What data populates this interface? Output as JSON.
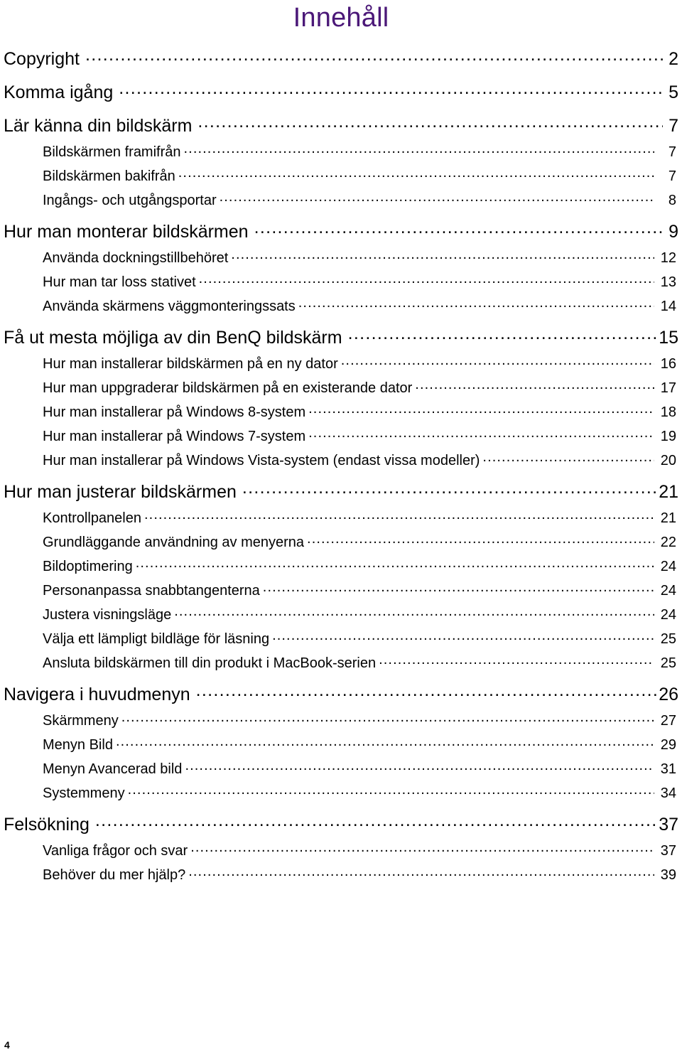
{
  "document": {
    "title": "Innehåll",
    "title_color": "#4B1878",
    "footer_page_number": "4"
  },
  "toc": {
    "entries": [
      {
        "level": 1,
        "label": "Copyright",
        "page": "2"
      },
      {
        "level": 1,
        "label": "Komma igång",
        "page": "5"
      },
      {
        "level": 1,
        "label": "Lär känna din bildskärm",
        "page": "7"
      },
      {
        "level": 2,
        "label": "Bildskärmen framifrån",
        "page": "7"
      },
      {
        "level": 2,
        "label": "Bildskärmen bakifrån",
        "page": "7"
      },
      {
        "level": 2,
        "label": "Ingångs- och utgångsportar",
        "page": "8"
      },
      {
        "level": 1,
        "label": "Hur man monterar bildskärmen",
        "page": "9"
      },
      {
        "level": 2,
        "label": "Använda dockningstillbehöret",
        "page": "12"
      },
      {
        "level": 2,
        "label": "Hur man tar loss stativet",
        "page": "13"
      },
      {
        "level": 2,
        "label": "Använda skärmens väggmonteringssats",
        "page": "14"
      },
      {
        "level": 1,
        "label": "Få ut mesta möjliga av din BenQ bildskärm",
        "page": "15"
      },
      {
        "level": 2,
        "label": "Hur man installerar bildskärmen på en ny dator",
        "page": "16"
      },
      {
        "level": 2,
        "label": "Hur man uppgraderar bildskärmen på en existerande dator",
        "page": "17"
      },
      {
        "level": 2,
        "label": "Hur man installerar på Windows 8-system",
        "page": "18"
      },
      {
        "level": 2,
        "label": "Hur man installerar på Windows 7-system",
        "page": "19"
      },
      {
        "level": 2,
        "label": "Hur man installerar på Windows Vista-system (endast vissa modeller)",
        "page": "20"
      },
      {
        "level": 1,
        "label": "Hur man justerar bildskärmen",
        "page": "21"
      },
      {
        "level": 2,
        "label": "Kontrollpanelen",
        "page": "21"
      },
      {
        "level": 2,
        "label": "Grundläggande användning av menyerna",
        "page": "22"
      },
      {
        "level": 2,
        "label": "Bildoptimering",
        "page": "24"
      },
      {
        "level": 2,
        "label": "Personanpassa snabbtangenterna",
        "page": "24"
      },
      {
        "level": 2,
        "label": "Justera visningsläge",
        "page": "24"
      },
      {
        "level": 2,
        "label": "Välja ett lämpligt bildläge för läsning",
        "page": "25"
      },
      {
        "level": 2,
        "label": "Ansluta bildskärmen till din produkt i MacBook-serien",
        "page": "25"
      },
      {
        "level": 1,
        "label": "Navigera i huvudmenyn",
        "page": "26"
      },
      {
        "level": 2,
        "label": "Skärmmeny",
        "page": "27"
      },
      {
        "level": 2,
        "label": "Menyn Bild",
        "page": "29"
      },
      {
        "level": 2,
        "label": "Menyn Avancerad bild",
        "page": "31"
      },
      {
        "level": 2,
        "label": "Systemmeny",
        "page": "34"
      },
      {
        "level": 1,
        "label": "Felsökning",
        "page": "37"
      },
      {
        "level": 2,
        "label": "Vanliga frågor och svar",
        "page": "37"
      },
      {
        "level": 2,
        "label": "Behöver du mer hjälp?",
        "page": "39"
      }
    ]
  }
}
